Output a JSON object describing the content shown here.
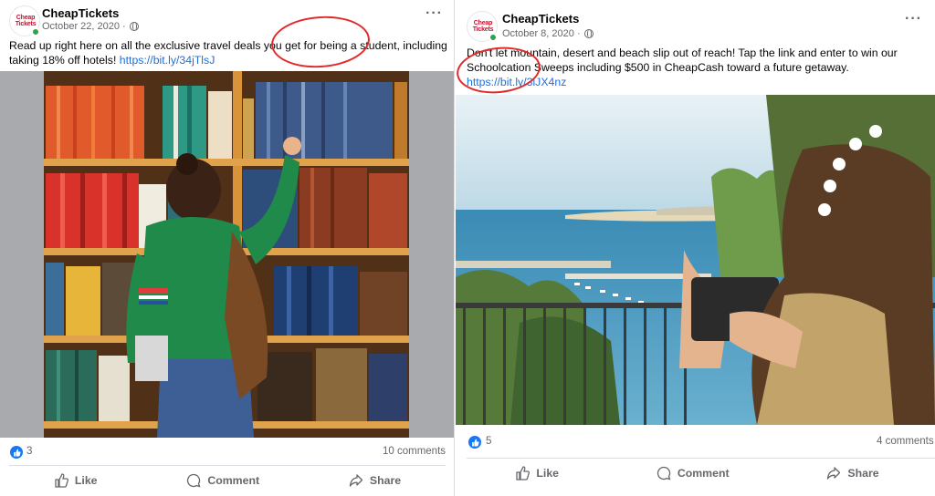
{
  "posts": [
    {
      "page_name": "CheapTickets",
      "logo_text_1": "Cheap",
      "logo_text_2": "Tickets",
      "date": "October 22, 2020 ·",
      "caption": "Read up right here on all the exclusive travel deals you get for being a student, including taking 18% off hotels!",
      "link": "https://bit.ly/34jTlsJ",
      "like_count": "3",
      "comments": "10 comments",
      "actions": {
        "like": "Like",
        "comment": "Comment",
        "share": "Share"
      }
    },
    {
      "page_name": "CheapTickets",
      "logo_text_1": "Cheap",
      "logo_text_2": "Tickets",
      "date": "October 8, 2020 ·",
      "caption_line1": "Don't let mountain, desert and beach slip out of reach! Tap the link and enter to win our",
      "caption_line2": "Schoolcation Sweeps including $500 in CheapCash toward a future getaway.",
      "link": "https://bit.ly/3iJX4nz",
      "like_count": "5",
      "comments": "4 comments",
      "actions": {
        "like": "Like",
        "comment": "Comment",
        "share": "Share"
      }
    }
  ],
  "colors": {
    "link": "#216fdb",
    "like_badge": "#1877f2",
    "secondary_text": "#65676b",
    "annotation_circle": "#e12a2a",
    "online_dot": "#31a24c",
    "brand_red": "#c8102e"
  },
  "icons": [
    "globe-icon",
    "more-options-icon",
    "like-icon",
    "comment-icon",
    "share-icon",
    "like-reaction-icon"
  ]
}
